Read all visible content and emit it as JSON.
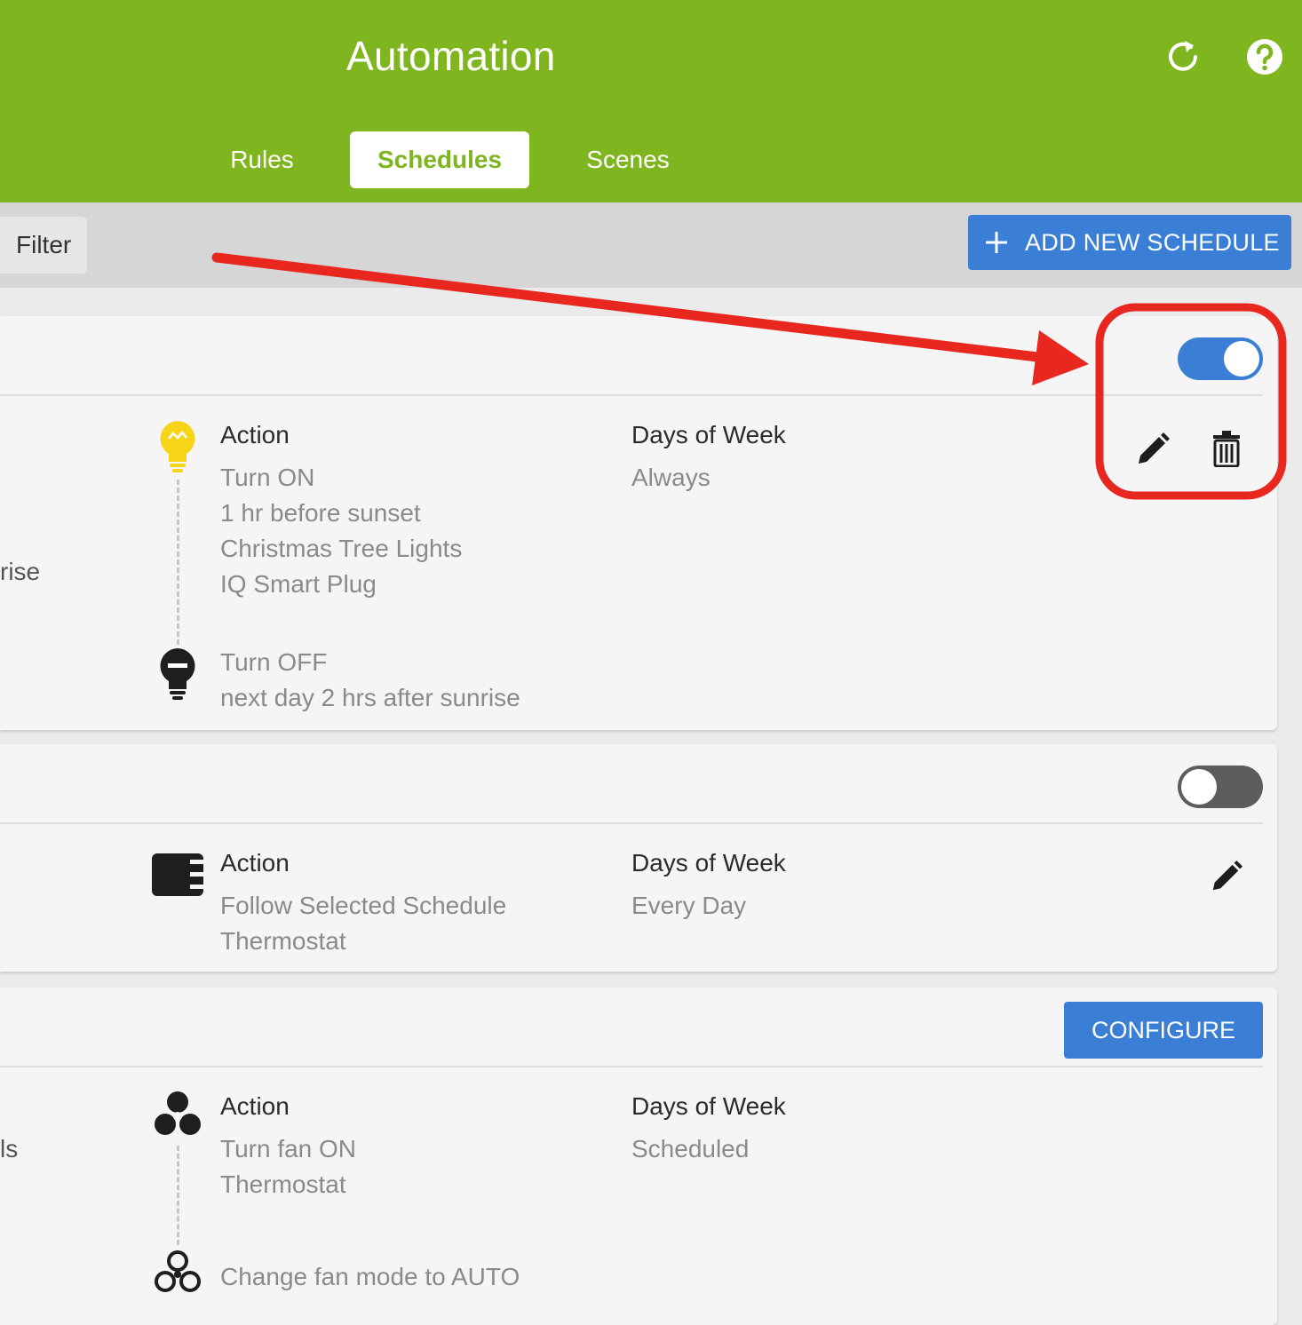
{
  "header": {
    "title": "Automation",
    "accent_color": "#7fb51e",
    "icons": [
      "refresh-icon",
      "help-icon"
    ],
    "tabs": [
      {
        "label": "Rules",
        "active": false
      },
      {
        "label": "Schedules",
        "active": true
      },
      {
        "label": "Scenes",
        "active": false
      }
    ]
  },
  "toolbar": {
    "filter_label": "Filter",
    "add_label": "ADD NEW SCHEDULE",
    "button_color": "#3a7fd5"
  },
  "schedules": [
    {
      "enabled": true,
      "left_partial_text": "rise",
      "action_label": "Action",
      "action_lines": [
        "Turn ON",
        "1 hr before sunset",
        "Christmas Tree Lights",
        "IQ Smart Plug"
      ],
      "end_lines": [
        "Turn OFF",
        "next day 2 hrs after sunrise"
      ],
      "days_label": "Days of Week",
      "days_value": "Always",
      "icons": [
        "light-bulb-on-icon",
        "light-bulb-off-icon",
        "edit-icon",
        "delete-icon"
      ]
    },
    {
      "enabled": false,
      "action_label": "Action",
      "action_lines": [
        "Follow Selected Schedule",
        "Thermostat"
      ],
      "days_label": "Days of Week",
      "days_value": "Every Day",
      "icons": [
        "schedule-card-icon",
        "edit-icon"
      ]
    },
    {
      "configure_label": "CONFIGURE",
      "left_partial_text": "ls",
      "action_label": "Action",
      "action_lines": [
        "Turn fan ON",
        "Thermostat"
      ],
      "end_lines": [
        "Change fan mode to AUTO"
      ],
      "days_label": "Days of Week",
      "days_value": "Scheduled",
      "icons": [
        "fan-filled-icon",
        "fan-outline-icon"
      ]
    }
  ],
  "annotation": {
    "color": "#e8281f",
    "shapes": [
      "arrow",
      "highlight-box"
    ]
  }
}
